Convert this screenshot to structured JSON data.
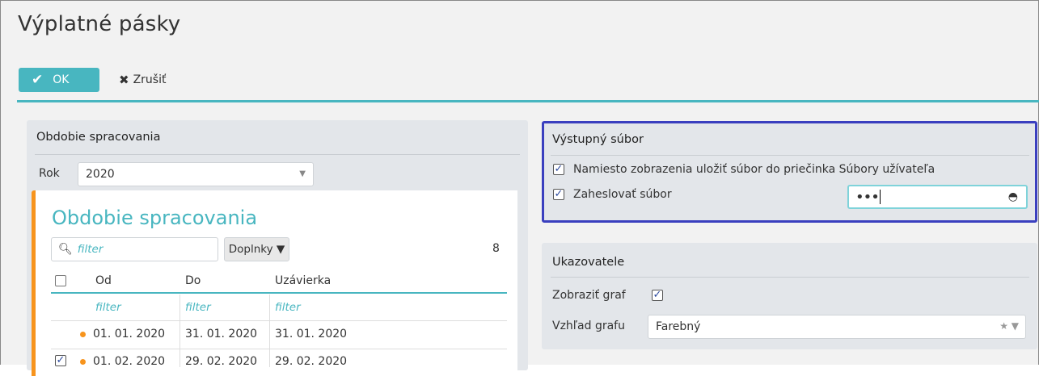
{
  "title": "Výplatné pásky",
  "toolbar": {
    "ok_label": "OK",
    "cancel_label": "Zrušiť"
  },
  "period_panel": {
    "title": "Obdobie spracovania",
    "rok_label": "Rok",
    "rok_value": "2020",
    "card_title": "Obdobie spracovania",
    "filter_placeholder": "filter",
    "doplnky_label": "Doplnky ▼",
    "count": "8",
    "columns": [
      "Od",
      "Do",
      "Uzávierka"
    ],
    "filters": [
      "filter",
      "filter",
      "filter"
    ],
    "rows": [
      {
        "od": "01. 01. 2020",
        "do": "31. 01. 2020",
        "uzavierka": "31. 01. 2020",
        "checked": false
      },
      {
        "od": "01. 02. 2020",
        "do": "29. 02. 2020",
        "uzavierka": "29. 02. 2020",
        "checked": true
      }
    ]
  },
  "output_panel": {
    "title": "Výstupný súbor",
    "save_label": "Namiesto zobrazenia uložiť súbor do priečinka Súbory užívateľa",
    "save_checked": true,
    "password_label": "Zaheslovať súbor",
    "password_checked": true,
    "password_value": "•••"
  },
  "indicators_panel": {
    "title": "Ukazovatele",
    "show_graph_label": "Zobraziť graf",
    "show_graph_checked": true,
    "graph_view_label": "Vzhľad grafu",
    "graph_view_value": "Farebný"
  },
  "colors": {
    "accent": "#48b6c0",
    "highlight": "#3a3fbf",
    "orange": "#f7941d"
  }
}
